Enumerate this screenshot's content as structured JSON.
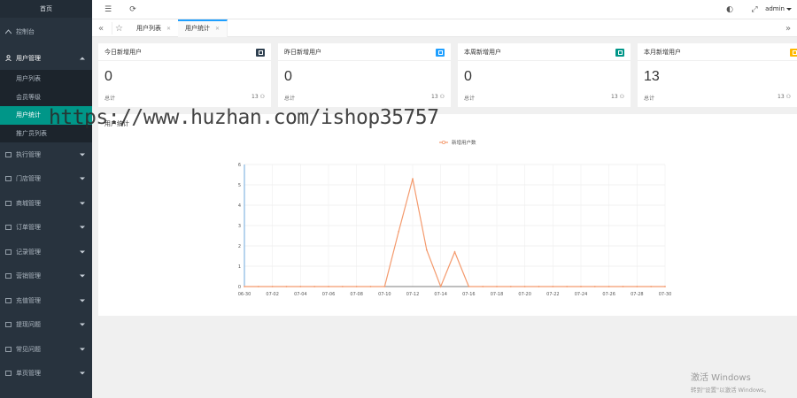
{
  "sidebar": {
    "logo": "首页",
    "dashboard": "控制台",
    "group_open": "用户管理",
    "subitems": [
      "用户列表",
      "会员等级",
      "用户统计",
      "推广员列表"
    ],
    "items": [
      "执行管理",
      "门店管理",
      "商城管理",
      "订单管理",
      "记录管理",
      "营销管理",
      "充值管理",
      "提现问题",
      "常见问题",
      "单页管理"
    ]
  },
  "header": {
    "user": "admin"
  },
  "tabs": [
    {
      "label": "用户列表"
    },
    {
      "label": "用户统计"
    }
  ],
  "cards": [
    {
      "title": "今日新增用户",
      "value": "0",
      "foot_label": "总计",
      "foot_value": "13",
      "badge_color": "#2f4050"
    },
    {
      "title": "昨日新增用户",
      "value": "0",
      "foot_label": "总计",
      "foot_value": "13",
      "badge_color": "#1e9fff"
    },
    {
      "title": "本周新增用户",
      "value": "0",
      "foot_label": "总计",
      "foot_value": "13",
      "badge_color": "#009688"
    },
    {
      "title": "本月新增用户",
      "value": "13",
      "foot_label": "总计",
      "foot_value": "13",
      "badge_color": "#ffb800"
    }
  ],
  "chart_panel": {
    "title": "用户统计"
  },
  "chart_data": {
    "type": "line",
    "title": "",
    "xlabel": "",
    "ylabel": "",
    "ylim": [
      0,
      6
    ],
    "yticks": [
      0,
      1,
      2,
      3,
      4,
      5,
      6
    ],
    "x_tick_labels": [
      "06-30",
      "07-02",
      "07-04",
      "07-06",
      "07-08",
      "07-10",
      "07-12",
      "07-14",
      "07-16",
      "07-18",
      "07-20",
      "07-22",
      "07-24",
      "07-26",
      "07-28",
      "07-30"
    ],
    "legend": "top-center",
    "grid": true,
    "series": [
      {
        "name": "新增用户数",
        "color": "#f49a6d",
        "x": [
          "06-30",
          "07-01",
          "07-02",
          "07-03",
          "07-04",
          "07-05",
          "07-06",
          "07-07",
          "07-08",
          "07-09",
          "07-10",
          "07-11",
          "07-12",
          "07-13",
          "07-14",
          "07-15",
          "07-16",
          "07-17",
          "07-18",
          "07-19",
          "07-20",
          "07-21",
          "07-22",
          "07-23",
          "07-24",
          "07-25",
          "07-26",
          "07-27",
          "07-28",
          "07-29",
          "07-30"
        ],
        "values": [
          0,
          0,
          0,
          0,
          0,
          0,
          0,
          0,
          0,
          0,
          0,
          2.7,
          5.3,
          1.8,
          0,
          1.7,
          0,
          0,
          0,
          0,
          0,
          0,
          0,
          0,
          0,
          0,
          0,
          0,
          0,
          0,
          0
        ]
      }
    ]
  },
  "watermark": "https://www.huzhan.com/ishop35757",
  "windows_notice": {
    "line1": "激活 Windows",
    "line2": "转到\"设置\"以激活 Windows。"
  }
}
